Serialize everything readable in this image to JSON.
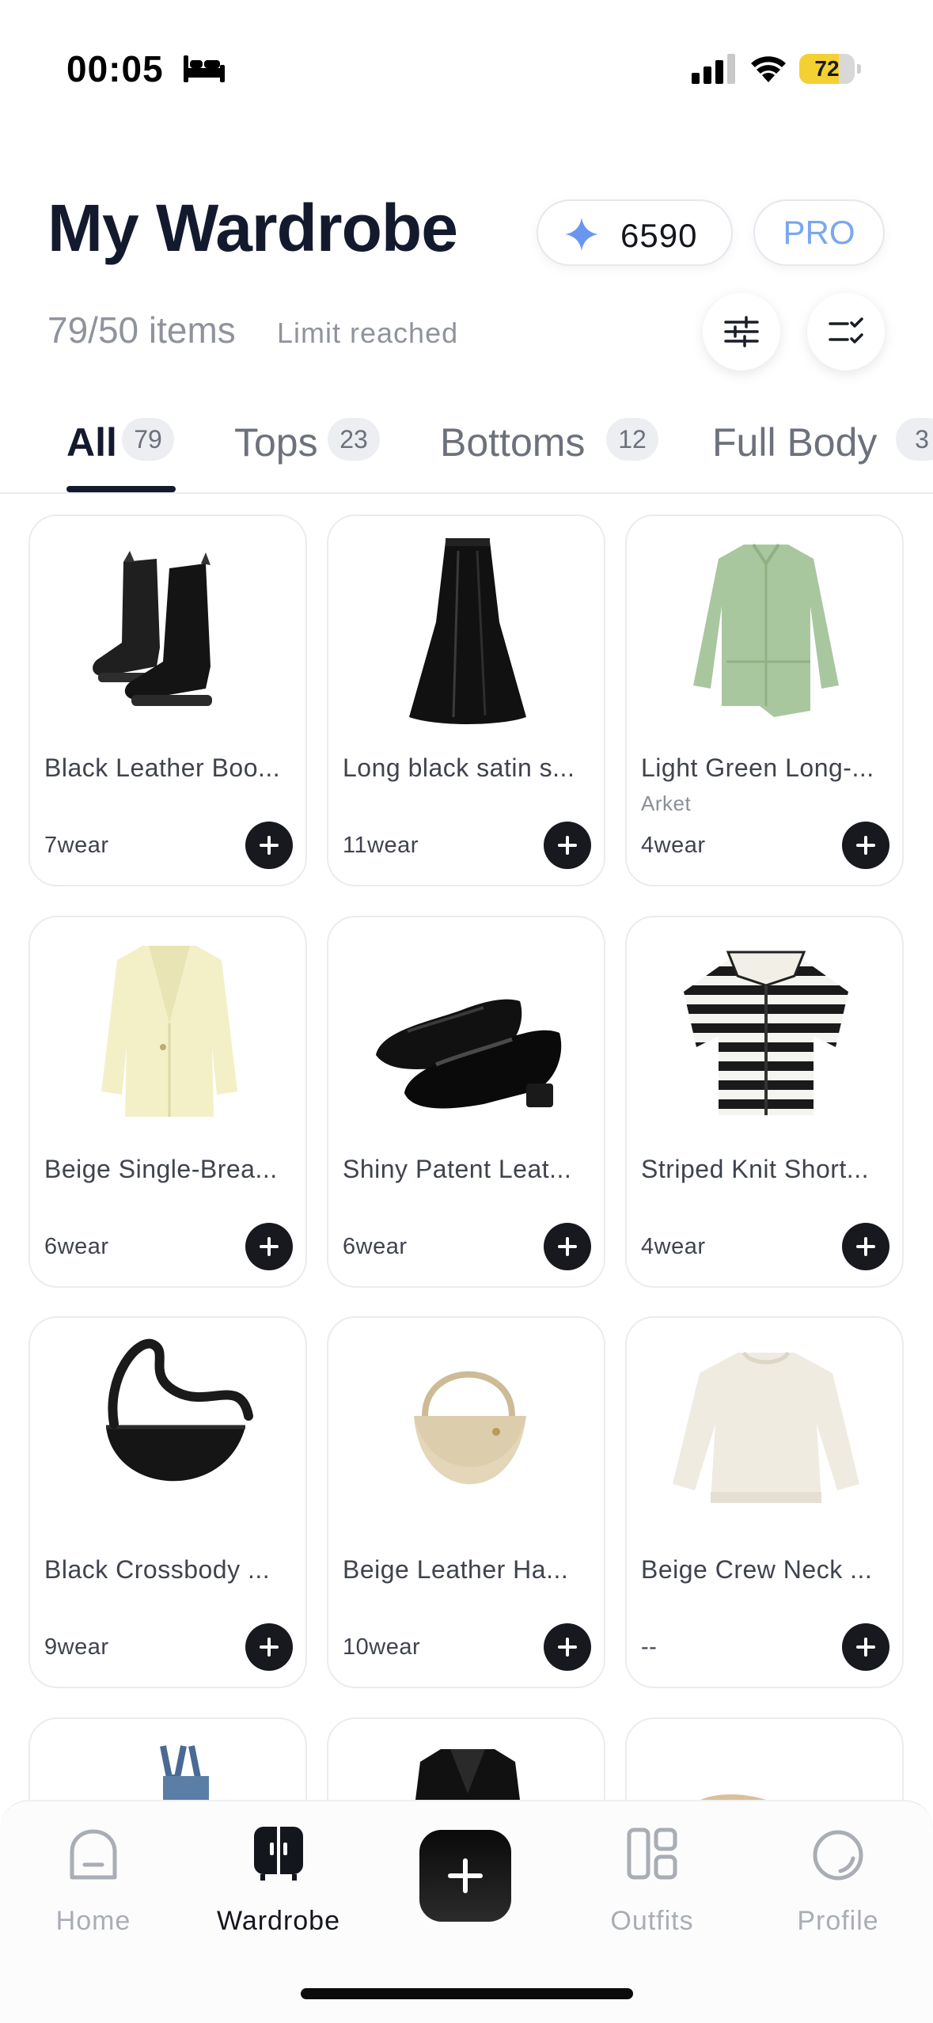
{
  "status_bar": {
    "time": "00:05",
    "battery_percent": "72",
    "battery_level": 0.72,
    "icons": [
      "bed-icon",
      "cellular-signal-icon",
      "wifi-icon",
      "battery-icon"
    ]
  },
  "header": {
    "title": "My Wardrobe",
    "credits": "6590",
    "pro_label": "PRO",
    "items_count": "79/50 items",
    "limit_text": "Limit reached",
    "accent_color": "#7aa7ef"
  },
  "tabs": [
    {
      "label": "All",
      "count": "79"
    },
    {
      "label": "Tops",
      "count": "23"
    },
    {
      "label": "Bottoms",
      "count": "12"
    },
    {
      "label": "Full Body",
      "count": "3"
    }
  ],
  "items": [
    {
      "name": "Black Leather Boo...",
      "brand": "",
      "wear": "7wear",
      "image": "black-boots"
    },
    {
      "name": "Long black satin s...",
      "brand": "",
      "wear": "11wear",
      "image": "black-satin-skirt"
    },
    {
      "name": "Light Green Long-...",
      "brand": "Arket",
      "wear": "4wear",
      "image": "green-shirt"
    },
    {
      "name": "Beige Single-Brea...",
      "brand": "",
      "wear": "6wear",
      "image": "beige-blazer"
    },
    {
      "name": "Shiny Patent Leat...",
      "brand": "",
      "wear": "6wear",
      "image": "patent-loafers"
    },
    {
      "name": "Striped Knit Short...",
      "brand": "",
      "wear": "4wear",
      "image": "striped-knit"
    },
    {
      "name": "Black Crossbody ...",
      "brand": "",
      "wear": "9wear",
      "image": "black-crossbody-bag"
    },
    {
      "name": "Beige Leather Ha...",
      "brand": "",
      "wear": "10wear",
      "image": "beige-handbag"
    },
    {
      "name": "Beige Crew Neck ...",
      "brand": "",
      "wear": "--",
      "image": "beige-sweater"
    }
  ],
  "bottom_nav": {
    "home": "Home",
    "wardrobe": "Wardrobe",
    "outfits": "Outfits",
    "profile": "Profile",
    "active": "Wardrobe"
  }
}
